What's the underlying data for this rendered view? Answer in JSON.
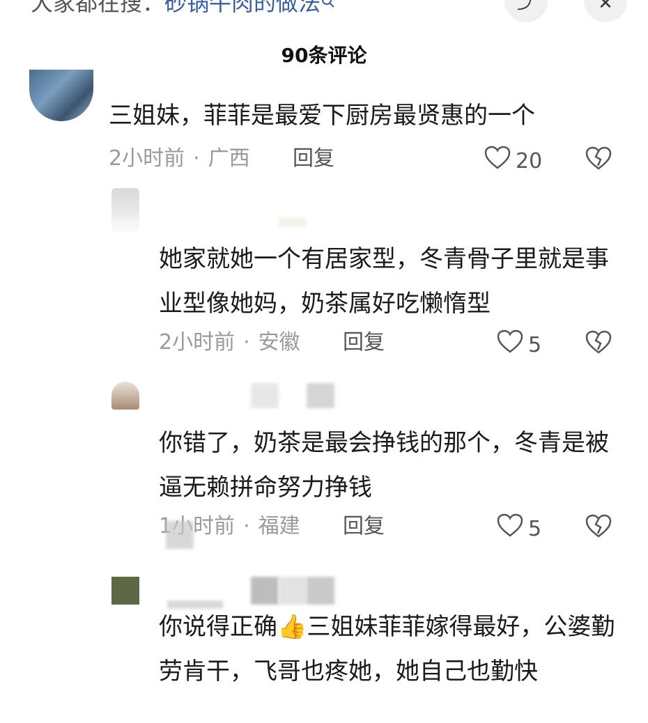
{
  "topbar": {
    "search_prefix": "大家都在搜：",
    "search_keyword": "砂锅牛肉的做法",
    "search_icon": "search-icon",
    "share_icon": "share-icon",
    "close_icon": "close-icon",
    "share_glyph": "⤴",
    "close_glyph": "✕"
  },
  "comments_title": "90条评论",
  "comments": [
    {
      "text": "三姐妹，菲菲是最爱下厨房最贤惠的一个",
      "time": "2小时前",
      "separator": "·",
      "location": "广西",
      "reply_label": "回复",
      "likes": "20"
    },
    {
      "text": "她家就她一个有居家型，冬青骨子里就是事业型像她妈，奶茶属好吃懒惰型",
      "time": "2小时前",
      "separator": "·",
      "location": "安徽",
      "reply_label": "回复",
      "likes": "5"
    },
    {
      "text": "你错了，奶茶是最会挣钱的那个，冬青是被逼无赖拼命努力挣钱",
      "time": "1小时前",
      "separator": "·",
      "location": "福建",
      "reply_label": "回复",
      "likes": "5"
    },
    {
      "text": "你说得正确👍三姐妹菲菲嫁得最好，公婆勤劳肯干，飞哥也疼她，她自己也勤快"
    }
  ],
  "colors": {
    "meta_gray": "#9a9a9a",
    "keyword_blue": "#3a5f9a"
  }
}
